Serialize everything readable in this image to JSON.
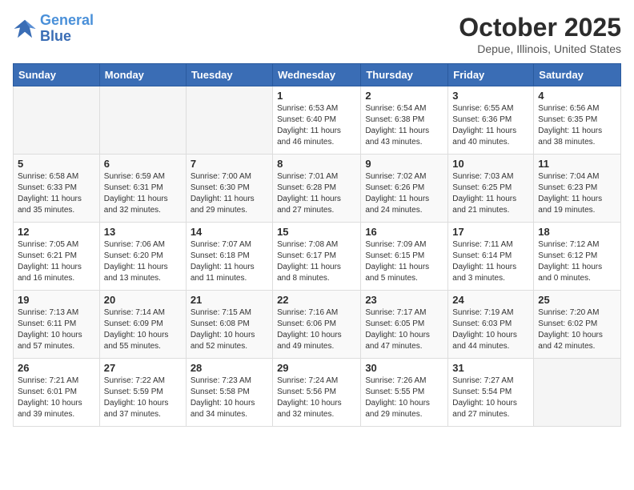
{
  "header": {
    "logo_line1": "General",
    "logo_line2": "Blue",
    "month": "October 2025",
    "location": "Depue, Illinois, United States"
  },
  "weekdays": [
    "Sunday",
    "Monday",
    "Tuesday",
    "Wednesday",
    "Thursday",
    "Friday",
    "Saturday"
  ],
  "weeks": [
    [
      {
        "day": "",
        "info": ""
      },
      {
        "day": "",
        "info": ""
      },
      {
        "day": "",
        "info": ""
      },
      {
        "day": "1",
        "info": "Sunrise: 6:53 AM\nSunset: 6:40 PM\nDaylight: 11 hours\nand 46 minutes."
      },
      {
        "day": "2",
        "info": "Sunrise: 6:54 AM\nSunset: 6:38 PM\nDaylight: 11 hours\nand 43 minutes."
      },
      {
        "day": "3",
        "info": "Sunrise: 6:55 AM\nSunset: 6:36 PM\nDaylight: 11 hours\nand 40 minutes."
      },
      {
        "day": "4",
        "info": "Sunrise: 6:56 AM\nSunset: 6:35 PM\nDaylight: 11 hours\nand 38 minutes."
      }
    ],
    [
      {
        "day": "5",
        "info": "Sunrise: 6:58 AM\nSunset: 6:33 PM\nDaylight: 11 hours\nand 35 minutes."
      },
      {
        "day": "6",
        "info": "Sunrise: 6:59 AM\nSunset: 6:31 PM\nDaylight: 11 hours\nand 32 minutes."
      },
      {
        "day": "7",
        "info": "Sunrise: 7:00 AM\nSunset: 6:30 PM\nDaylight: 11 hours\nand 29 minutes."
      },
      {
        "day": "8",
        "info": "Sunrise: 7:01 AM\nSunset: 6:28 PM\nDaylight: 11 hours\nand 27 minutes."
      },
      {
        "day": "9",
        "info": "Sunrise: 7:02 AM\nSunset: 6:26 PM\nDaylight: 11 hours\nand 24 minutes."
      },
      {
        "day": "10",
        "info": "Sunrise: 7:03 AM\nSunset: 6:25 PM\nDaylight: 11 hours\nand 21 minutes."
      },
      {
        "day": "11",
        "info": "Sunrise: 7:04 AM\nSunset: 6:23 PM\nDaylight: 11 hours\nand 19 minutes."
      }
    ],
    [
      {
        "day": "12",
        "info": "Sunrise: 7:05 AM\nSunset: 6:21 PM\nDaylight: 11 hours\nand 16 minutes."
      },
      {
        "day": "13",
        "info": "Sunrise: 7:06 AM\nSunset: 6:20 PM\nDaylight: 11 hours\nand 13 minutes."
      },
      {
        "day": "14",
        "info": "Sunrise: 7:07 AM\nSunset: 6:18 PM\nDaylight: 11 hours\nand 11 minutes."
      },
      {
        "day": "15",
        "info": "Sunrise: 7:08 AM\nSunset: 6:17 PM\nDaylight: 11 hours\nand 8 minutes."
      },
      {
        "day": "16",
        "info": "Sunrise: 7:09 AM\nSunset: 6:15 PM\nDaylight: 11 hours\nand 5 minutes."
      },
      {
        "day": "17",
        "info": "Sunrise: 7:11 AM\nSunset: 6:14 PM\nDaylight: 11 hours\nand 3 minutes."
      },
      {
        "day": "18",
        "info": "Sunrise: 7:12 AM\nSunset: 6:12 PM\nDaylight: 11 hours\nand 0 minutes."
      }
    ],
    [
      {
        "day": "19",
        "info": "Sunrise: 7:13 AM\nSunset: 6:11 PM\nDaylight: 10 hours\nand 57 minutes."
      },
      {
        "day": "20",
        "info": "Sunrise: 7:14 AM\nSunset: 6:09 PM\nDaylight: 10 hours\nand 55 minutes."
      },
      {
        "day": "21",
        "info": "Sunrise: 7:15 AM\nSunset: 6:08 PM\nDaylight: 10 hours\nand 52 minutes."
      },
      {
        "day": "22",
        "info": "Sunrise: 7:16 AM\nSunset: 6:06 PM\nDaylight: 10 hours\nand 49 minutes."
      },
      {
        "day": "23",
        "info": "Sunrise: 7:17 AM\nSunset: 6:05 PM\nDaylight: 10 hours\nand 47 minutes."
      },
      {
        "day": "24",
        "info": "Sunrise: 7:19 AM\nSunset: 6:03 PM\nDaylight: 10 hours\nand 44 minutes."
      },
      {
        "day": "25",
        "info": "Sunrise: 7:20 AM\nSunset: 6:02 PM\nDaylight: 10 hours\nand 42 minutes."
      }
    ],
    [
      {
        "day": "26",
        "info": "Sunrise: 7:21 AM\nSunset: 6:01 PM\nDaylight: 10 hours\nand 39 minutes."
      },
      {
        "day": "27",
        "info": "Sunrise: 7:22 AM\nSunset: 5:59 PM\nDaylight: 10 hours\nand 37 minutes."
      },
      {
        "day": "28",
        "info": "Sunrise: 7:23 AM\nSunset: 5:58 PM\nDaylight: 10 hours\nand 34 minutes."
      },
      {
        "day": "29",
        "info": "Sunrise: 7:24 AM\nSunset: 5:56 PM\nDaylight: 10 hours\nand 32 minutes."
      },
      {
        "day": "30",
        "info": "Sunrise: 7:26 AM\nSunset: 5:55 PM\nDaylight: 10 hours\nand 29 minutes."
      },
      {
        "day": "31",
        "info": "Sunrise: 7:27 AM\nSunset: 5:54 PM\nDaylight: 10 hours\nand 27 minutes."
      },
      {
        "day": "",
        "info": ""
      }
    ]
  ]
}
